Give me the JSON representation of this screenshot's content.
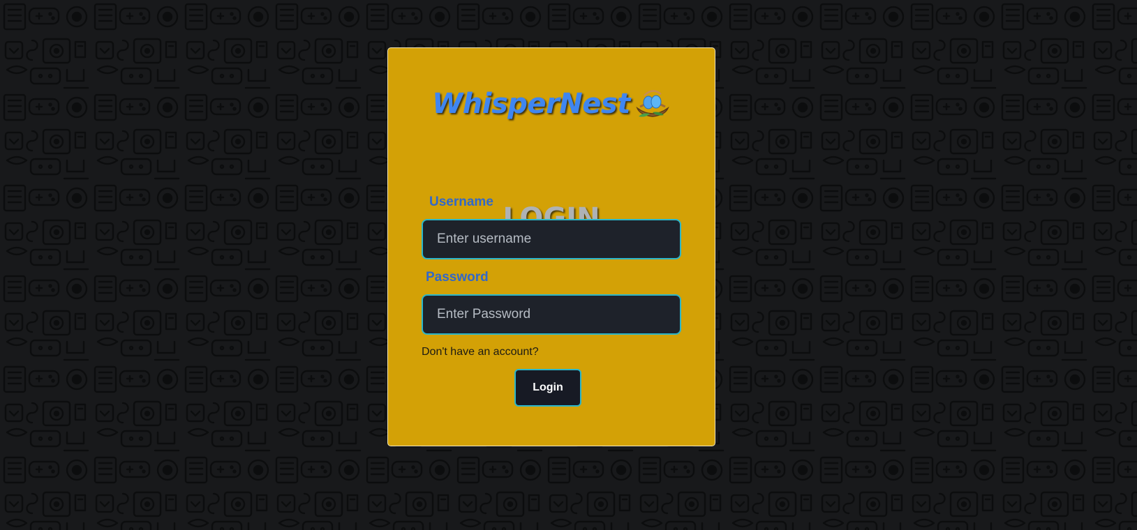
{
  "brand": {
    "name": "WhisperNest",
    "icon": "nest-icon"
  },
  "form": {
    "title": "LOGIN",
    "username_label": "Username",
    "username_placeholder": "Enter username",
    "username_value": "",
    "password_label": "Password",
    "password_placeholder": "Enter Password",
    "password_value": "",
    "signup_text": "Don't have an account?",
    "submit_label": "Login"
  },
  "colors": {
    "background": "#18191b",
    "card": "#d3a106",
    "brand": "#3f86f0",
    "label": "#3268c9",
    "input_bg": "#1e222a",
    "accent_border": "#2cb6c9"
  }
}
